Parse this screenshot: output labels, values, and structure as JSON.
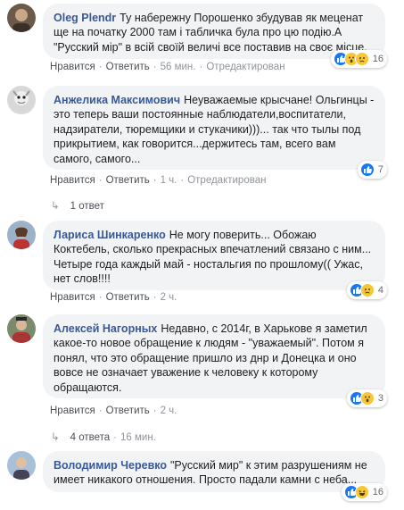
{
  "comments": [
    {
      "author": "Oleg Plendr",
      "text": "Ту набережну Порошенко збудував як меценат ще на початку 2000 там і табличка була про цю подію.А \"Русский мір\" в всій своїй величі все поставив на своє місце.",
      "reaction_count": "16",
      "reactions": [
        "like",
        "wow",
        "sad"
      ],
      "like_label": "Нравится",
      "reply_label": "Ответить",
      "time": "56 мин.",
      "edited": "Отредактирован"
    },
    {
      "author": "Анжелика Максимович",
      "text": "Неуважаемые крысчане! Ольгинцы - это теперь ваши постоянные наблюдатели,воспитатели, надзиратели, тюремщики и стукачики)))... так что тылы под прикрытием, как говорится...держитесь там, всего вам самого, самого...",
      "reaction_count": "7",
      "reactions": [
        "like"
      ],
      "like_label": "Нравится",
      "reply_label": "Ответить",
      "time": "1 ч.",
      "edited": "Отредактирован"
    },
    {
      "author": "Лариса Шинкаренко",
      "text": "Не могу поверить... Обожаю Коктебель, сколько прекрасных впечатлений связано с ним... Четыре года каждый май - ностальгия по прошлому(( Ужас, нет слов!!!!",
      "reaction_count": "4",
      "reactions": [
        "like",
        "sad"
      ],
      "like_label": "Нравится",
      "reply_label": "Ответить",
      "time": "2 ч."
    },
    {
      "author": "Алексей Нагорных",
      "text": "Недавно, с 2014г, в Харькове я заметил какое-то новое обращение к людям - \"уважаемый\". Потом я понял, что это обращение пришло из днр и Донецка и оно вовсе не означает уважение к человеку к которому обращаются.",
      "reaction_count": "3",
      "reactions": [
        "like",
        "wow"
      ],
      "like_label": "Нравится",
      "reply_label": "Ответить",
      "time": "2 ч."
    },
    {
      "author": "Володимир Черевко",
      "text": "\"Русский мир\" к этим разрушениям не имеет никакого отношения. Просто падали камни с неба...",
      "reaction_count": "16",
      "reactions": [
        "like",
        "haha"
      ]
    }
  ],
  "reply_threads": [
    {
      "label": "1 ответ",
      "time": ""
    },
    {
      "label": "4 ответа",
      "time": "16 мин."
    }
  ],
  "separator": "·",
  "arrow": "↳",
  "colors": {
    "author_link": "#385898",
    "bubble_bg": "#f2f3f5",
    "meta": "#90949c",
    "like_blue": "#1877f2",
    "emoji_yellow": "#f7c735"
  }
}
